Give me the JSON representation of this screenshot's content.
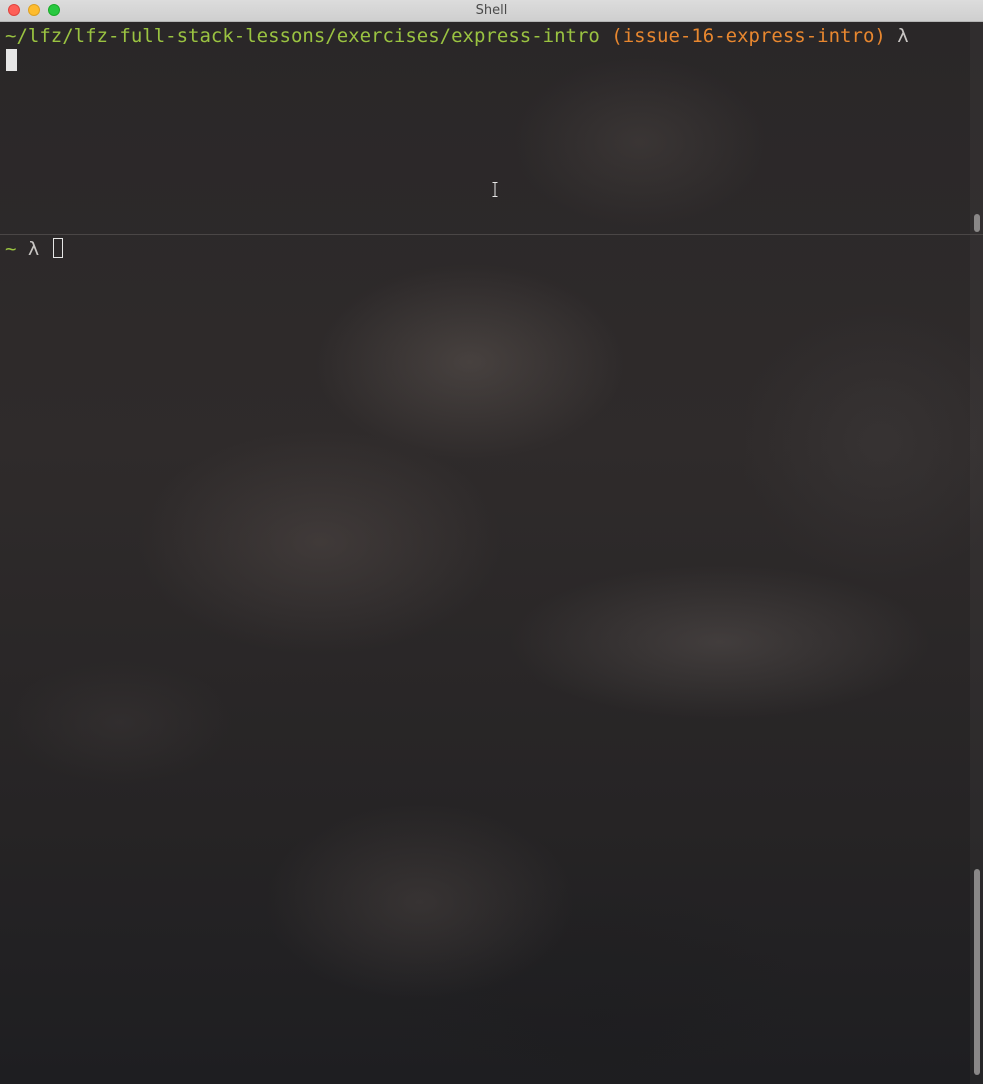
{
  "window": {
    "title": "Shell"
  },
  "panes": {
    "top": {
      "path": "~/lfz/lfz-full-stack-lessons/exercises/express-intro",
      "branch": "(issue-16-express-intro)",
      "prompt_symbol": "λ"
    },
    "bottom": {
      "path": "~",
      "prompt_symbol": "λ"
    }
  },
  "colors": {
    "path": "#9ac341",
    "branch": "#e8872f",
    "prompt": "#c9c6c4",
    "close": "#fe5f57",
    "minimize": "#febc2e",
    "zoom": "#28c840"
  },
  "icons": {
    "mouse_pointer": "ibeam-cursor-icon"
  }
}
